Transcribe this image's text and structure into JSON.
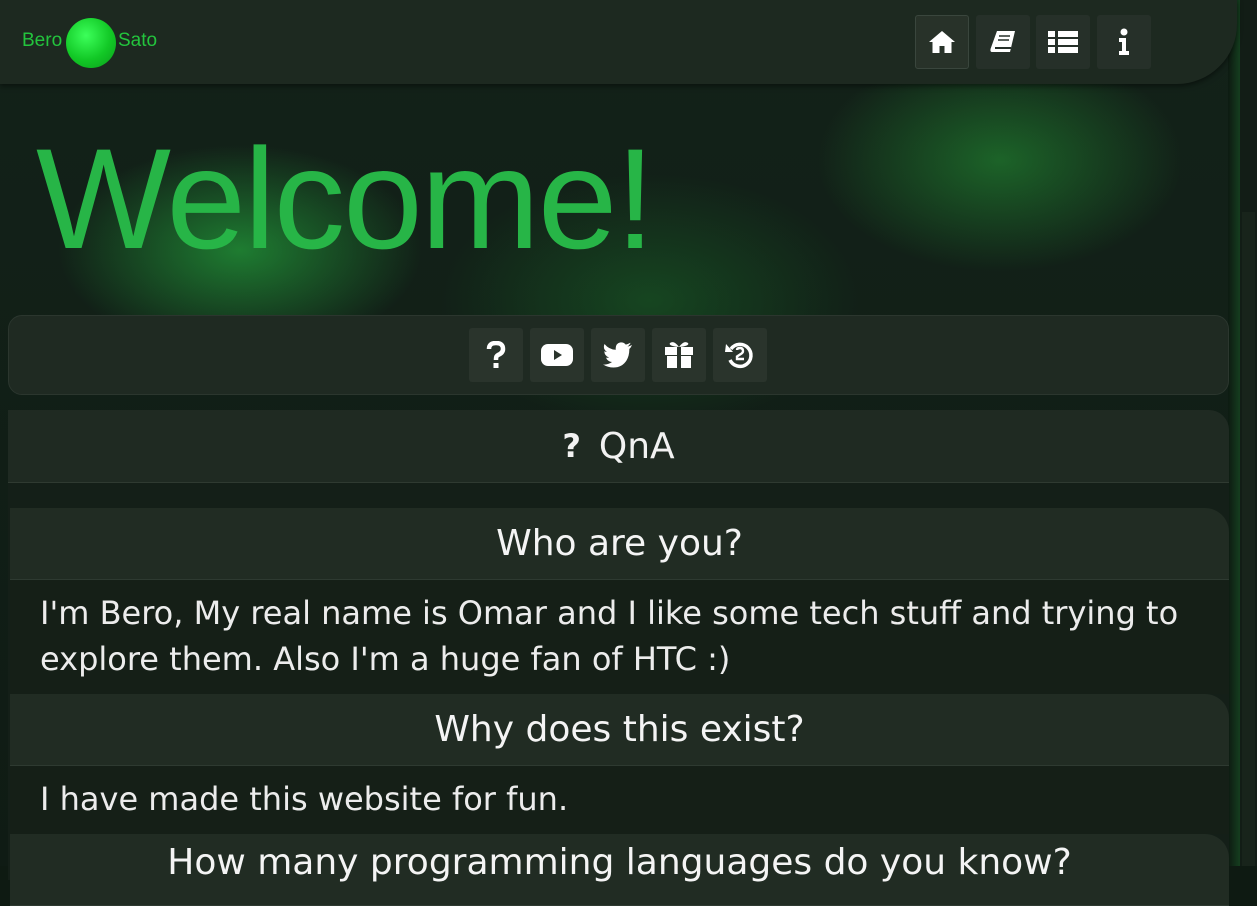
{
  "header": {
    "logo_left": "Bero",
    "logo_right": "Sato",
    "nav": [
      {
        "icon": "home-icon",
        "active": true
      },
      {
        "icon": "book-icon",
        "active": false
      },
      {
        "icon": "list-icon",
        "active": false
      },
      {
        "icon": "info-icon",
        "active": false
      }
    ]
  },
  "hero": {
    "title": "Welcome!"
  },
  "social": [
    {
      "icon": "question-icon"
    },
    {
      "icon": "youtube-icon"
    },
    {
      "icon": "twitter-icon"
    },
    {
      "icon": "gift-icon"
    },
    {
      "icon": "history-icon"
    }
  ],
  "qna": {
    "title": "QnA",
    "items": [
      {
        "question": "Who are you?",
        "answer": "I'm Bero, My real name is Omar and I like some tech stuff and trying to explore them. Also I'm a huge fan of HTC :)"
      },
      {
        "question": "Why does this exist?",
        "answer": "I have made this website for fun."
      },
      {
        "question": "How many programming languages do you know?",
        "answer": ""
      }
    ]
  },
  "colors": {
    "accent": "#27b547",
    "logo_ball": "#12c826",
    "panel": "#1f2a22",
    "background": "#0e1a12"
  }
}
